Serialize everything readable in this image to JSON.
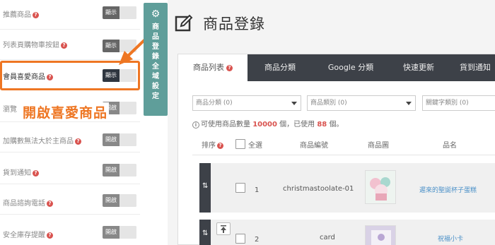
{
  "settings": {
    "rows": [
      {
        "label": "推薦商品",
        "help": "?",
        "toggle": "顯示"
      },
      {
        "label": "列表頁購物車按鈕",
        "help": "?",
        "toggle": "顯示"
      },
      {
        "label": "會員喜愛商品",
        "help": "?",
        "toggle": "顯示"
      },
      {
        "label": "瀏覽",
        "help": "",
        "toggle": "開啟"
      },
      {
        "label": "加購數無法大於主商品",
        "help": "?",
        "toggle": "開啟"
      },
      {
        "label": "貨到通知",
        "help": "?",
        "toggle": "開啟"
      },
      {
        "label": "商品諮詢電話",
        "help": "?",
        "toggle": "開啟"
      },
      {
        "label": "安全庫存提醒",
        "help": "?",
        "toggle": "開啟"
      }
    ]
  },
  "callout": {
    "text": "開啟喜愛商品"
  },
  "side_tab": {
    "chars": [
      "商",
      "品",
      "登",
      "錄",
      "全",
      "域",
      "設",
      "定"
    ],
    "icon": "gear-icon"
  },
  "main": {
    "title": "商品登錄",
    "tabs": [
      {
        "label": "商品列表",
        "help": "?"
      },
      {
        "label": "商品分類",
        "help": ""
      },
      {
        "label": "Google 分類",
        "help": ""
      },
      {
        "label": "快速更新",
        "help": ""
      },
      {
        "label": "貨到通知",
        "help": ""
      }
    ],
    "filters": [
      {
        "value": "商品分類 (0)"
      },
      {
        "value": "商品類別 (0)"
      },
      {
        "value": "關鍵字類別 (0)"
      }
    ],
    "info": {
      "prefix": "可使用商品數量 ",
      "limit": "10000",
      "mid": " 個，已使用 ",
      "used": "88",
      "suffix": " 個。"
    },
    "columns": {
      "sort": "排序",
      "select_all": "全選",
      "code": "商品編號",
      "image": "商品圖",
      "name": "品名"
    },
    "products": [
      {
        "index": "1",
        "code": "christmastoolate-01",
        "name": "遲來的聖誕杯子蛋糕"
      },
      {
        "index": "2",
        "code": "card",
        "name": "祝福小卡"
      }
    ]
  },
  "colors": {
    "accent": "#ee7623",
    "teal": "#5f9e9a",
    "dark_tab": "#3d4148",
    "help_red": "#d9534f",
    "link": "#4a90c8"
  }
}
